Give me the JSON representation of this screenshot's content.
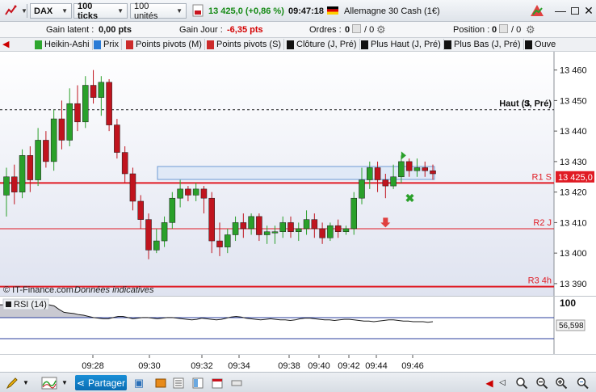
{
  "toolbar": {
    "symbol": "DAX",
    "period": "100 ticks",
    "units": "100 unités",
    "price_change": "13 425,0 (+0,86 %)",
    "time": "09:47:18",
    "instrument": "Allemagne 30 Cash (1€)"
  },
  "infobar": {
    "latent_label": "Gain latent :",
    "latent_value": "0,00 pts",
    "day_label": "Gain Jour :",
    "day_value": "-6,35 pts",
    "orders_label": "Ordres :",
    "orders_value": "0",
    "orders_suffix": "/ 0",
    "position_label": "Position :",
    "position_value": "0",
    "position_suffix": "/ 0"
  },
  "indicators": [
    {
      "label": "Heikin-Ashi",
      "color": "#2ea62e"
    },
    {
      "label": "Prix",
      "color": "#2a7bd6"
    },
    {
      "label": "Points pivots (M)",
      "color": "#cc2b2b"
    },
    {
      "label": "Points pivots (S)",
      "color": "#cc2b2b"
    },
    {
      "label": "Clôture (J, Pré)",
      "color": "#111111"
    },
    {
      "label": "Plus Haut (J, Pré)",
      "color": "#111111"
    },
    {
      "label": "Plus Bas (J, Pré)",
      "color": "#111111"
    },
    {
      "label": "Ouve",
      "color": "#111111"
    }
  ],
  "chart": {
    "watermark": "© IT-Finance.com",
    "disclaimer": "Données indicatives",
    "line_labels": {
      "haut": "Haut (J, Pré)",
      "haut_overlap": "S",
      "r1": "R1 S",
      "r2": "R2 J",
      "r3": "R3 4h"
    },
    "current_price": "13 425,0",
    "colors": {
      "up": "#2aa02a",
      "down": "#c0141e",
      "pivot": "#e01b24",
      "rsi": "#1a1a1a",
      "bg_top": "#ffffff",
      "bg_bottom": "#dfe3f0"
    }
  },
  "rsi": {
    "label": "RSI (14)",
    "axis_label": "100",
    "value_label": "56,598"
  },
  "bottombar": {
    "share_label": "Partager"
  },
  "chart_data": {
    "type": "candlestick",
    "style": "Heikin-Ashi",
    "y_axis_labels": [
      "13 460",
      "13 450",
      "13 440",
      "13 430",
      "13 420",
      "13 410",
      "13 400",
      "13 390"
    ],
    "x_axis_labels": [
      "09:28",
      "09:30",
      "09:32",
      "09:34",
      "09:38",
      "09:40",
      "09:42",
      "09:44",
      "09:46"
    ],
    "ylim": [
      13386,
      13466
    ],
    "levels": {
      "haut_j_pre": 13447,
      "r1_s": 13423,
      "r2_j": 13408,
      "r3_4h": 13389
    },
    "candles": [
      [
        13419,
        13425,
        13412,
        13428
      ],
      [
        13425,
        13420,
        13416,
        13429
      ],
      [
        13420,
        13432,
        13418,
        13434
      ],
      [
        13432,
        13424,
        13420,
        13435
      ],
      [
        13424,
        13437,
        13422,
        13441
      ],
      [
        13437,
        13430,
        13428,
        13440
      ],
      [
        13430,
        13444,
        13427,
        13447
      ],
      [
        13444,
        13437,
        13434,
        13450
      ],
      [
        13437,
        13449,
        13435,
        13454
      ],
      [
        13449,
        13443,
        13440,
        13455
      ],
      [
        13443,
        13455,
        13441,
        13458
      ],
      [
        13455,
        13451,
        13449,
        13460
      ],
      [
        13451,
        13456,
        13445,
        13458
      ],
      [
        13456,
        13442,
        13440,
        13457
      ],
      [
        13442,
        13433,
        13431,
        13444
      ],
      [
        13433,
        13426,
        13423,
        13435
      ],
      [
        13426,
        13417,
        13414,
        13428
      ],
      [
        13417,
        13411,
        13408,
        13419
      ],
      [
        13411,
        13401,
        13398,
        13413
      ],
      [
        13401,
        13404,
        13400,
        13408
      ],
      [
        13404,
        13410,
        13402,
        13412
      ],
      [
        13410,
        13418,
        13408,
        13420
      ],
      [
        13418,
        13421,
        13415,
        13424
      ],
      [
        13421,
        13419,
        13417,
        13422
      ],
      [
        13419,
        13421,
        13417,
        13423
      ],
      [
        13421,
        13418,
        13413,
        13422
      ],
      [
        13418,
        13404,
        13400,
        13420
      ],
      [
        13404,
        13402,
        13399,
        13410
      ],
      [
        13402,
        13406,
        13400,
        13408
      ],
      [
        13406,
        13410,
        13404,
        13412
      ],
      [
        13410,
        13408,
        13405,
        13413
      ],
      [
        13408,
        13412,
        13406,
        13413
      ],
      [
        13412,
        13406,
        13404,
        13413
      ],
      [
        13406,
        13407,
        13403,
        13409
      ],
      [
        13407,
        13407,
        13403,
        13409
      ],
      [
        13407,
        13410,
        13405,
        13412
      ],
      [
        13410,
        13407,
        13405,
        13412
      ],
      [
        13407,
        13408,
        13404,
        13410
      ],
      [
        13408,
        13411,
        13406,
        13414
      ],
      [
        13411,
        13408,
        13405,
        13413
      ],
      [
        13408,
        13405,
        13403,
        13410
      ],
      [
        13405,
        13409,
        13404,
        13410
      ],
      [
        13409,
        13407,
        13405,
        13411
      ],
      [
        13407,
        13408,
        13406,
        13409
      ],
      [
        13408,
        13418,
        13406,
        13420
      ],
      [
        13418,
        13424,
        13416,
        13428
      ],
      [
        13424,
        13428,
        13421,
        13430
      ],
      [
        13428,
        13424,
        13420,
        13430
      ],
      [
        13424,
        13422,
        13418,
        13426
      ],
      [
        13422,
        13425,
        13421,
        13429
      ],
      [
        13425,
        13430,
        13423,
        13432
      ],
      [
        13430,
        13427,
        13425,
        13431
      ],
      [
        13427,
        13428,
        13425,
        13431
      ],
      [
        13428,
        13427,
        13425,
        13430
      ],
      [
        13427,
        13426,
        13424,
        13429
      ]
    ],
    "markers": [
      {
        "type": "sell-arrow",
        "price": 13410,
        "color": "#e0403f"
      },
      {
        "type": "buy-cross",
        "price": 13418,
        "color": "#2aa02a"
      },
      {
        "type": "flag",
        "price": 13432,
        "color": "#2aa02a"
      }
    ],
    "rsi_series": [
      86,
      86,
      86,
      86,
      86,
      86,
      86,
      86,
      86,
      86,
      86,
      84,
      78,
      73,
      72,
      71,
      69,
      68,
      66,
      64,
      63,
      62,
      62,
      64,
      66,
      66,
      64,
      62,
      63,
      64,
      64,
      63,
      62,
      63,
      64,
      64,
      63,
      62,
      61,
      60,
      61,
      63,
      62,
      61,
      60,
      61,
      63,
      65,
      66,
      65,
      63,
      62,
      61,
      60,
      61,
      62,
      61,
      60,
      60,
      59,
      60,
      62,
      63,
      63,
      62,
      61,
      60,
      60,
      59,
      60,
      61,
      61,
      60,
      59,
      58,
      58,
      57,
      58,
      59,
      60,
      60,
      59,
      58,
      58,
      57,
      57,
      57,
      56,
      57
    ],
    "rsi_ylim": [
      0,
      100
    ]
  }
}
